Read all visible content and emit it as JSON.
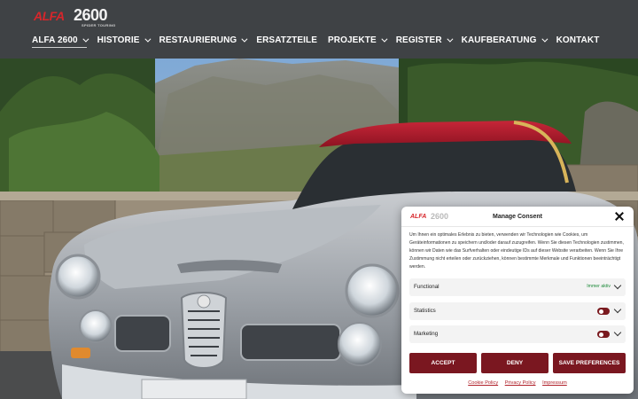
{
  "header": {
    "logo": {
      "brand": "ALFA",
      "model": "2600",
      "subtitle": "SPIDER TOURING"
    },
    "nav": [
      {
        "label": "ALFA 2600",
        "dropdown": true,
        "active": true
      },
      {
        "label": "HISTORIE",
        "dropdown": true
      },
      {
        "label": "RESTAURIERUNG",
        "dropdown": true
      },
      {
        "label": "ERSATZTEILE",
        "dropdown": false
      },
      {
        "label": "PROJEKTE",
        "dropdown": true
      },
      {
        "label": "REGISTER",
        "dropdown": true
      },
      {
        "label": "KAUFBERATUNG",
        "dropdown": true
      },
      {
        "label": "KONTAKT",
        "dropdown": false
      }
    ]
  },
  "consent": {
    "logo": {
      "brand": "ALFA",
      "model": "2600"
    },
    "title": "Manage Consent",
    "text": "Um Ihnen ein optimales Erlebnis zu bieten, verwenden wir Technologien wie Cookies, um Geräteinformationen zu speichern und/oder darauf zuzugreifen. Wenn Sie diesen Technologien zustimmen, können wir Daten wie das Surfverhalten oder eindeutige IDs auf dieser Website verarbeiten. Wenn Sie Ihre Zustimmung nicht erteilen oder zurückziehen, können bestimmte Merkmale und Funktionen beeinträchtigt werden.",
    "categories": [
      {
        "label": "Functional",
        "status": "Immer aktiv"
      },
      {
        "label": "Statistics",
        "toggle": "off"
      },
      {
        "label": "Marketing",
        "toggle": "off"
      }
    ],
    "buttons": {
      "accept": "ACCEPT",
      "deny": "DENY",
      "preferences": "SAVE PREFERENCES"
    },
    "links": {
      "cookie_policy": "Cookie Policy",
      "privacy_policy": "Privacy Policy",
      "impressum": "Impressum"
    }
  },
  "colors": {
    "header_bg": "#3f4245",
    "brand_red": "#d7262b",
    "button_bg": "#7a1720",
    "always_active": "#1e8a3a"
  }
}
